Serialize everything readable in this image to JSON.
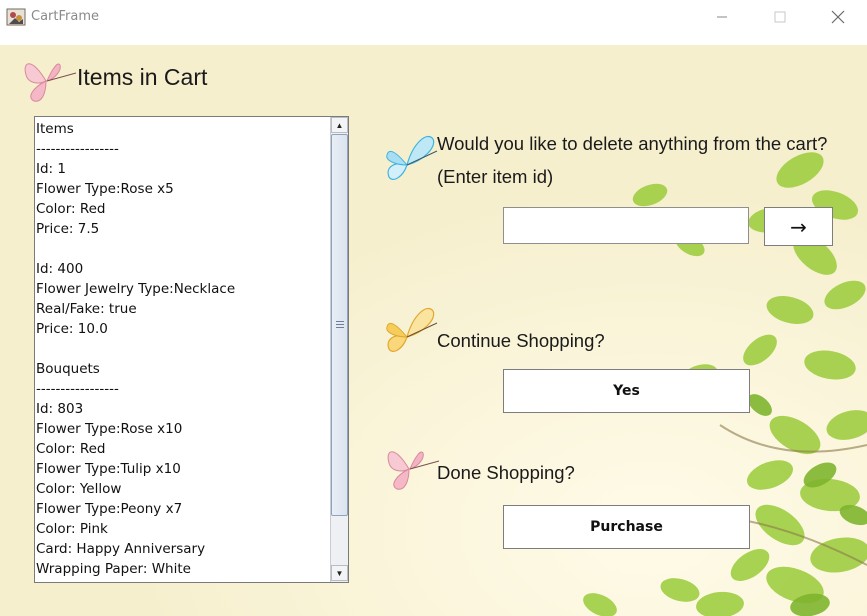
{
  "window": {
    "title": "CartFrame",
    "minimize_glyph": "—",
    "maximize_glyph": "☐",
    "close_glyph": "✕"
  },
  "heading": "Items in Cart",
  "cart_list": {
    "lines": [
      "Items",
      "-----------------",
      "Id: 1",
      "Flower Type:Rose x5",
      "Color: Red",
      "Price: 7.5",
      "",
      "Id: 400",
      "Flower Jewelry Type:Necklace",
      "Real/Fake: true",
      "Price: 10.0",
      "",
      "Bouquets",
      "-----------------",
      "Id: 803",
      "Flower Type:Rose x10",
      "Color: Red",
      "Flower Type:Tulip x10",
      "Color: Yellow",
      "Flower Type:Peony x7",
      "Color: Pink",
      "Card: Happy Anniversary",
      "Wrapping Paper: White",
      "Bouquet Price: 79.0"
    ],
    "scroll_up_glyph": "▲",
    "scroll_down_glyph": "▼"
  },
  "delete_section": {
    "prompt_line1": "Would you like to delete anything from the cart?",
    "prompt_line2": "(Enter item id)",
    "input_value": "",
    "submit_label": "→"
  },
  "continue_section": {
    "prompt": "Continue Shopping?",
    "button_label": "Yes"
  },
  "done_section": {
    "prompt": "Done Shopping?",
    "button_label": "Purchase"
  },
  "icons": {
    "app": "flower-app-icon",
    "heading_butterfly": "pink-butterfly-icon",
    "delete_butterfly": "blue-butterfly-icon",
    "continue_butterfly": "yellow-butterfly-icon",
    "done_butterfly": "pink-butterfly-icon"
  },
  "colors": {
    "background": "#fbf7df",
    "leaf_green": "#9ccc3c",
    "pink_butterfly": "#f2a5b4",
    "blue_butterfly": "#5ec8ee",
    "yellow_butterfly": "#f1c04c"
  }
}
